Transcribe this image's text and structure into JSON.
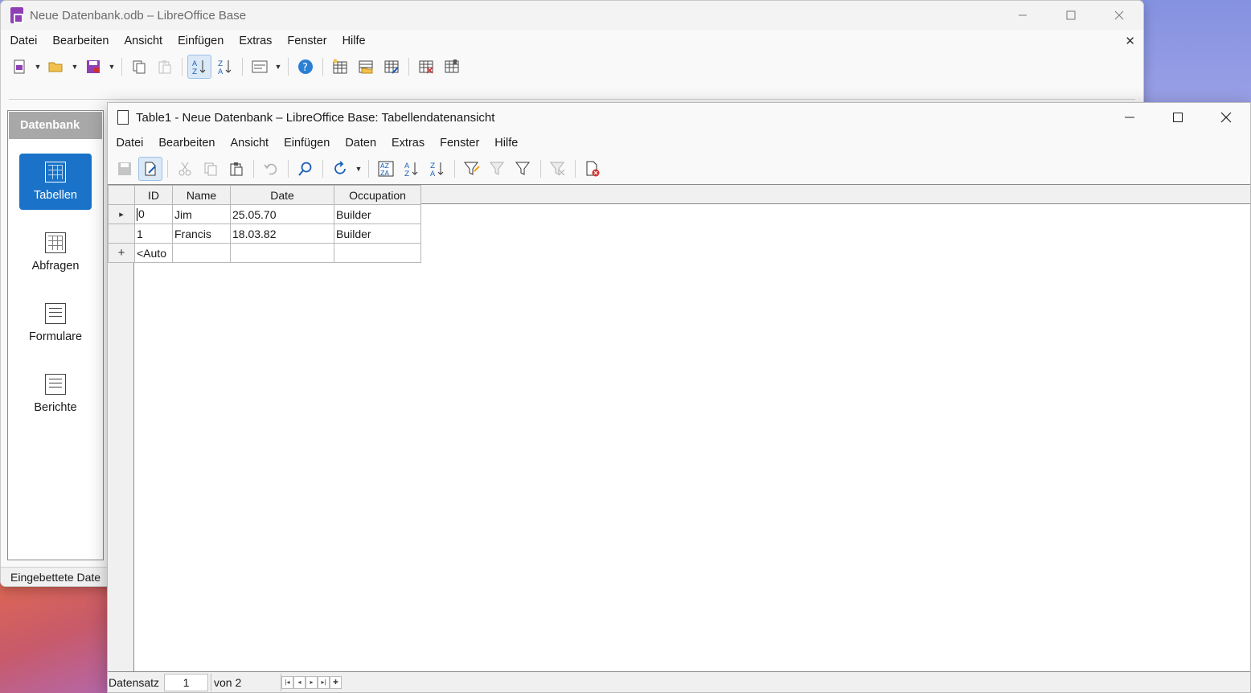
{
  "back_window": {
    "title": "Neue Datenbank.odb – LibreOffice Base",
    "menu": [
      "Datei",
      "Bearbeiten",
      "Ansicht",
      "Einfügen",
      "Extras",
      "Fenster",
      "Hilfe"
    ],
    "doc_close": "✕",
    "sidebar": {
      "header": "Datenbank",
      "items": [
        {
          "label": "Tabellen",
          "icon": "table-icon",
          "selected": true
        },
        {
          "label": "Abfragen",
          "icon": "query-icon",
          "selected": false
        },
        {
          "label": "Formulare",
          "icon": "form-icon",
          "selected": false
        },
        {
          "label": "Berichte",
          "icon": "report-icon",
          "selected": false
        }
      ]
    },
    "status": "Eingebettete Date"
  },
  "front_window": {
    "title": "Table1 - Neue Datenbank – LibreOffice Base: Tabellendatenansicht",
    "menu": [
      "Datei",
      "Bearbeiten",
      "Ansicht",
      "Einfügen",
      "Daten",
      "Extras",
      "Fenster",
      "Hilfe"
    ],
    "table": {
      "columns": [
        "ID",
        "Name",
        "Date",
        "Occupation"
      ],
      "rows": [
        {
          "marker": "▸",
          "cells": [
            "0",
            "Jim",
            "25.05.70",
            "Builder"
          ]
        },
        {
          "marker": "",
          "cells": [
            "1",
            "Francis",
            "18.03.82",
            "Builder"
          ]
        },
        {
          "marker": "+",
          "cells": [
            "<Auto",
            "",
            "",
            ""
          ]
        }
      ]
    },
    "navigation": {
      "label": "Datensatz",
      "current": "1",
      "of_text": "von 2"
    }
  },
  "colors": {
    "accent": "#1a73c8",
    "sidebar_header": "#a8a8a8",
    "base_icon": "#8f3fb5"
  }
}
